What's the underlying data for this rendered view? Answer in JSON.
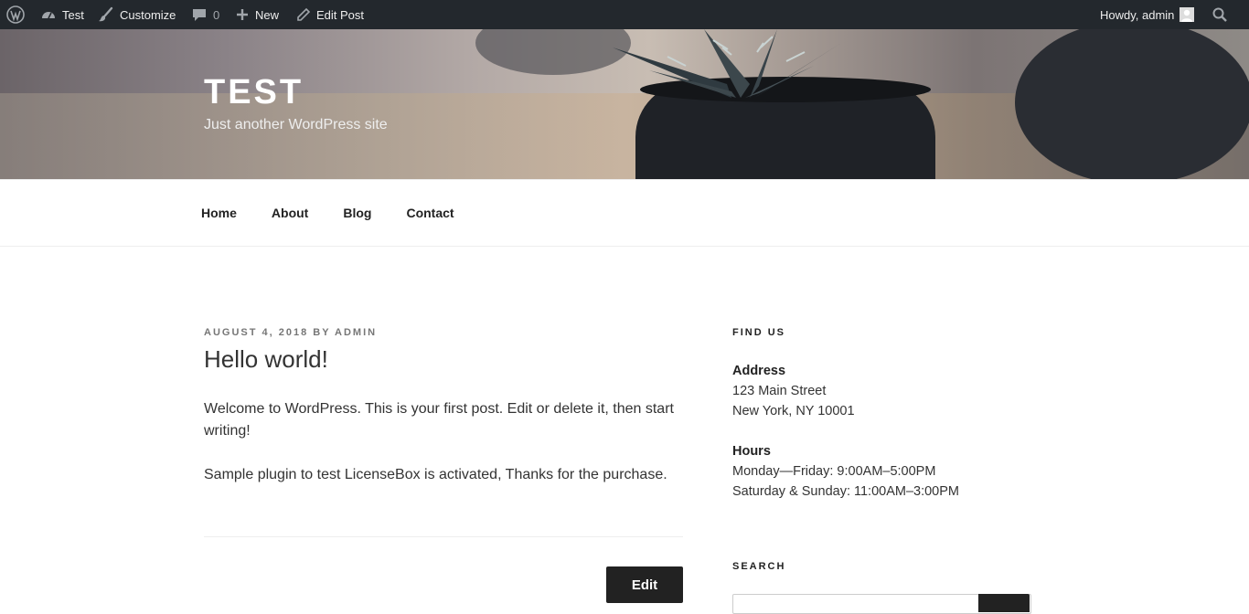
{
  "admin_bar": {
    "site_name": "Test",
    "customize": "Customize",
    "comments_count": "0",
    "new": "New",
    "edit_post": "Edit Post",
    "greeting": "Howdy, admin"
  },
  "header": {
    "title": "TEST",
    "description": "Just another WordPress site"
  },
  "nav": {
    "items": [
      "Home",
      "About",
      "Blog",
      "Contact"
    ]
  },
  "post": {
    "date": "AUGUST 4, 2018",
    "by": "BY",
    "author": "ADMIN",
    "title": "Hello world!",
    "paragraph_1": "Welcome to WordPress. This is your first post. Edit or delete it, then start writing!",
    "paragraph_2": "Sample plugin to test LicenseBox is activated, Thanks for the purchase.",
    "edit_label": "Edit"
  },
  "sidebar": {
    "find_us": {
      "title": "FIND US",
      "address_label": "Address",
      "address_line_1": "123 Main Street",
      "address_line_2": "New York, NY 10001",
      "hours_label": "Hours",
      "hours_line_1": "Monday—Friday: 9:00AM–5:00PM",
      "hours_line_2": "Saturday & Sunday: 11:00AM–3:00PM"
    },
    "search": {
      "title": "SEARCH"
    }
  },
  "icons": {
    "wordpress": "wordpress-logo-icon",
    "dashboard": "dashboard-icon",
    "customize": "paintbrush-icon",
    "comments": "comment-bubble-icon",
    "new": "plus-icon",
    "edit": "pencil-icon",
    "avatar": "avatar-icon",
    "search": "search-icon"
  },
  "colors": {
    "admin_bar_bg": "#23282d",
    "admin_bar_text": "#eeeeee",
    "button_bg": "#222222"
  }
}
